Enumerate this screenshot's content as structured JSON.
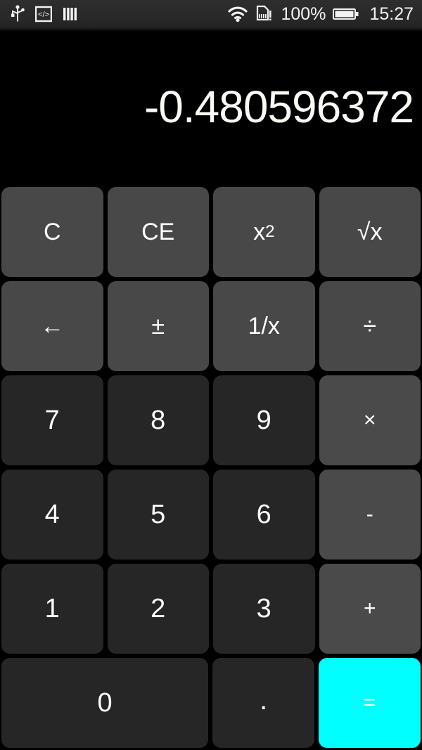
{
  "statusbar": {
    "left_icons": [
      {
        "name": "usb-icon",
        "label": "USB"
      },
      {
        "name": "developer-code-icon",
        "label": "</>"
      },
      {
        "name": "barcode-icon",
        "label": "||||"
      }
    ],
    "wifi_icon": "wifi-icon",
    "sim_icon": "sim-card-alert-icon",
    "battery_percent": "100%",
    "battery_icon": "battery-full-icon",
    "time": "15:27"
  },
  "display": {
    "value": "-0.480596372"
  },
  "keypad": {
    "rows": [
      [
        {
          "label": "C",
          "name": "key-clear",
          "type": "func"
        },
        {
          "label": "CE",
          "name": "key-clear-entry",
          "type": "func"
        },
        {
          "label": "x",
          "sup": "2",
          "name": "key-square",
          "type": "func"
        },
        {
          "label": "√x",
          "name": "key-square-root",
          "type": "func"
        }
      ],
      [
        {
          "label": "←",
          "name": "key-backspace",
          "type": "func"
        },
        {
          "label": "±",
          "name": "key-plus-minus",
          "type": "func"
        },
        {
          "label": "1/x",
          "name": "key-reciprocal",
          "type": "func"
        },
        {
          "label": "÷",
          "name": "key-divide",
          "type": "func"
        }
      ],
      [
        {
          "label": "7",
          "name": "key-7",
          "type": "num"
        },
        {
          "label": "8",
          "name": "key-8",
          "type": "num"
        },
        {
          "label": "9",
          "name": "key-9",
          "type": "num"
        },
        {
          "label": "×",
          "name": "key-multiply",
          "type": "op"
        }
      ],
      [
        {
          "label": "4",
          "name": "key-4",
          "type": "num"
        },
        {
          "label": "5",
          "name": "key-5",
          "type": "num"
        },
        {
          "label": "6",
          "name": "key-6",
          "type": "num"
        },
        {
          "label": "-",
          "name": "key-subtract",
          "type": "op"
        }
      ],
      [
        {
          "label": "1",
          "name": "key-1",
          "type": "num"
        },
        {
          "label": "2",
          "name": "key-2",
          "type": "num"
        },
        {
          "label": "3",
          "name": "key-3",
          "type": "num"
        },
        {
          "label": "+",
          "name": "key-add",
          "type": "op"
        }
      ],
      [
        {
          "label": "0",
          "name": "key-0",
          "type": "num",
          "wide": true
        },
        {
          "label": ".",
          "name": "key-decimal-point",
          "type": "num"
        },
        {
          "label": "=",
          "name": "key-equals",
          "type": "eq"
        }
      ]
    ]
  },
  "colors": {
    "background": "#000000",
    "function_key": "#484848",
    "number_key": "#262626",
    "operator_key": "#4a4a4a",
    "equals_key": "#00ffff",
    "text": "#ffffff",
    "statusbar": "#2b2b2b"
  }
}
